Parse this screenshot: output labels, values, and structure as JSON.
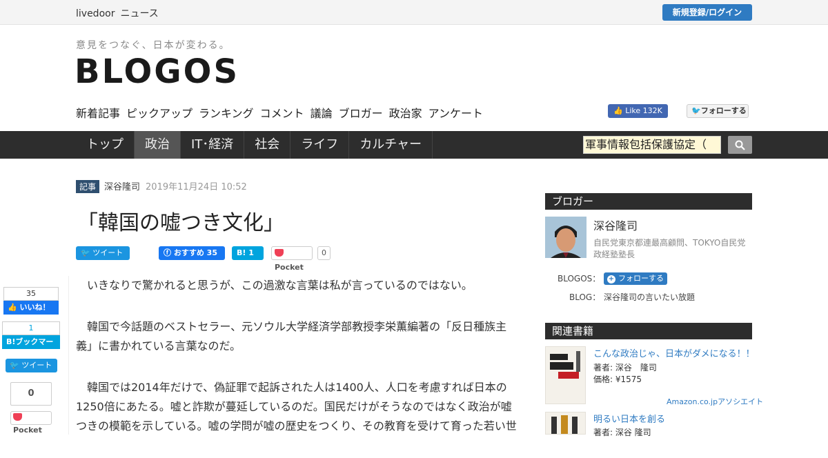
{
  "topbar": {
    "brand": "livedoor",
    "news": "ニュース",
    "signup": "新規登録/ログイン"
  },
  "header": {
    "tagline": "意見をつなぐ、日本が変わる。",
    "logo": "BLOGOS",
    "subnav": [
      "新着記事",
      "ピックアップ",
      "ランキング",
      "コメント",
      "議論",
      "ブロガー",
      "政治家",
      "アンケート"
    ],
    "fb_like": "Like 132K",
    "tw_follow": "フォローする"
  },
  "mainnav": {
    "items": [
      "トップ",
      "政治",
      "IT･経済",
      "社会",
      "ライフ",
      "カルチャー"
    ],
    "active": "政治",
    "search_value": "軍事情報包括保護協定（",
    "search_icon": "search-icon"
  },
  "article": {
    "tag": "記事",
    "author": "深谷隆司",
    "date": "2019年11月24日 10:52",
    "title": "「韓国の嘘つき文化」",
    "share": {
      "tweet": "ツイート",
      "fb": "おすすめ 35",
      "hatena": "1",
      "pocket": "Pocket",
      "pocket_count": "0"
    },
    "paragraphs": [
      "いきなりで驚かれると思うが、この過激な言葉は私が言っているのではない。",
      "韓国で今話題のベストセラー、元ソウル大学経済学部教授李栄薫編著の「反日種族主義」に書かれている言葉なのだ。",
      "韓国では2014年だけで、偽証罪で起訴された人は1400人、人口を考慮すれば日本の1250倍にあたる。嘘と詐欺が蔓延しているのだ。国民だけがそうなのではなく政治が嘘つきの模範を示している。嘘の学問が嘘の歴史をつくり、その教育を受けて育った若い世"
    ]
  },
  "float_share": {
    "like_count": "35",
    "like_label": "いいね！",
    "hatena_count": "1",
    "hatena_label": "B!ブックマーク",
    "tweet": "ツイート",
    "pocket_count": "0",
    "pocket_label": "Pocket"
  },
  "sidebar": {
    "blogger_heading": "ブロガー",
    "blogger_name": "深谷隆司",
    "blogger_desc": "自民党東京都連最高顧問、TOKYO自民党政経塾塾長",
    "blogos_label": "BLOGOS：",
    "follow": "フォローする",
    "blog_label": "BLOG：",
    "blog_name": "深谷隆司の言いたい放題",
    "books_heading": "関連書籍",
    "books": [
      {
        "title": "こんな政治じゃ、日本がダメになる！！",
        "author": "著者: 深谷　隆司",
        "price": "価格: ¥1575"
      },
      {
        "title": "明るい日本を創る",
        "author": "著者: 深谷 隆司",
        "price": ""
      }
    ],
    "amazon": "Amazon.co.jpアソシエイト"
  }
}
